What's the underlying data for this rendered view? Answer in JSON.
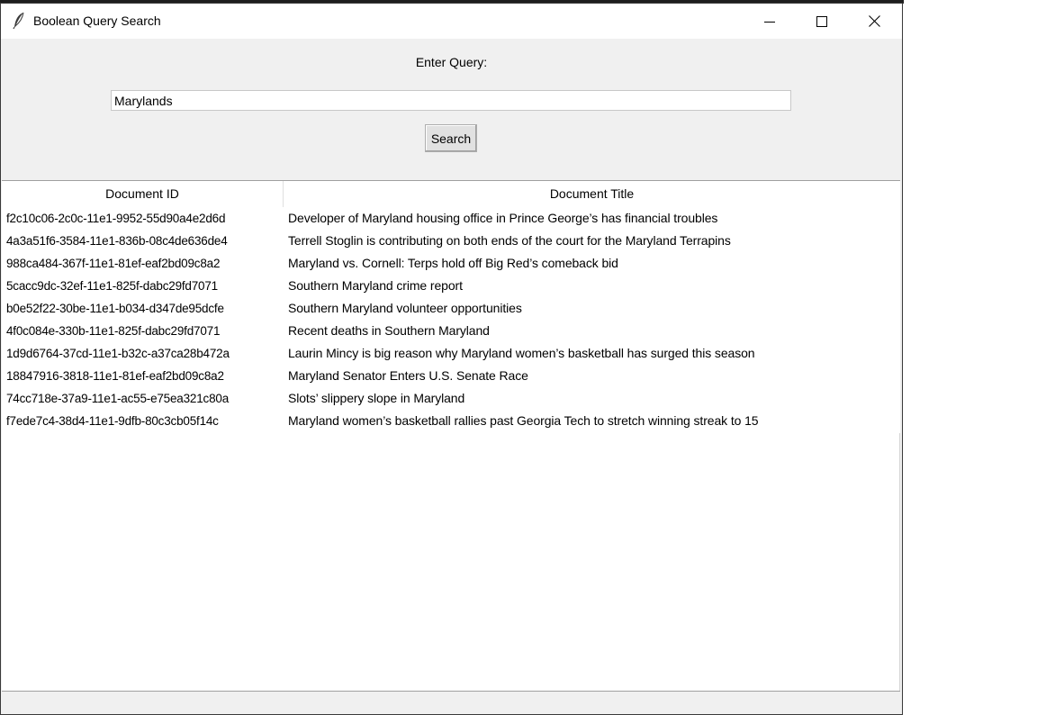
{
  "window": {
    "title": "Boolean Query Search"
  },
  "query": {
    "label": "Enter Query:",
    "value": "Marylands"
  },
  "search_button": {
    "label": "Search"
  },
  "table": {
    "columns": [
      "Document ID",
      "Document Title"
    ],
    "rows": [
      {
        "id": "f2c10c06-2c0c-11e1-9952-55d90a4e2d6d",
        "title": "Developer of Maryland housing office in Prince George’s has financial troubles"
      },
      {
        "id": "4a3a51f6-3584-11e1-836b-08c4de636de4",
        "title": "Terrell Stoglin is contributing on both ends of the court for the Maryland Terrapins"
      },
      {
        "id": "988ca484-367f-11e1-81ef-eaf2bd09c8a2",
        "title": "Maryland vs. Cornell: Terps hold off Big Red’s comeback bid"
      },
      {
        "id": "5cacc9dc-32ef-11e1-825f-dabc29fd7071",
        "title": "Southern Maryland crime report"
      },
      {
        "id": "b0e52f22-30be-11e1-b034-d347de95dcfe",
        "title": "Southern Maryland volunteer opportunities"
      },
      {
        "id": "4f0c084e-330b-11e1-825f-dabc29fd7071",
        "title": "Recent deaths in Southern Maryland"
      },
      {
        "id": "1d9d6764-37cd-11e1-b32c-a37ca28b472a",
        "title": "Laurin Mincy is big reason why Maryland women’s basketball has surged this season"
      },
      {
        "id": "18847916-3818-11e1-81ef-eaf2bd09c8a2",
        "title": "Maryland Senator Enters U.S. Senate Race"
      },
      {
        "id": "74cc718e-37a9-11e1-ac55-e75ea321c80a",
        "title": "Slots’ slippery slope in Maryland"
      },
      {
        "id": "f7ede7c4-38d4-11e1-9dfb-80c3cb05f14c",
        "title": "Maryland women’s basketball rallies past Georgia Tech to stretch winning streak to 15"
      }
    ]
  },
  "icons": {
    "app": "feather-icon",
    "minimize": "minimize-icon",
    "maximize": "maximize-icon",
    "close": "close-icon"
  }
}
